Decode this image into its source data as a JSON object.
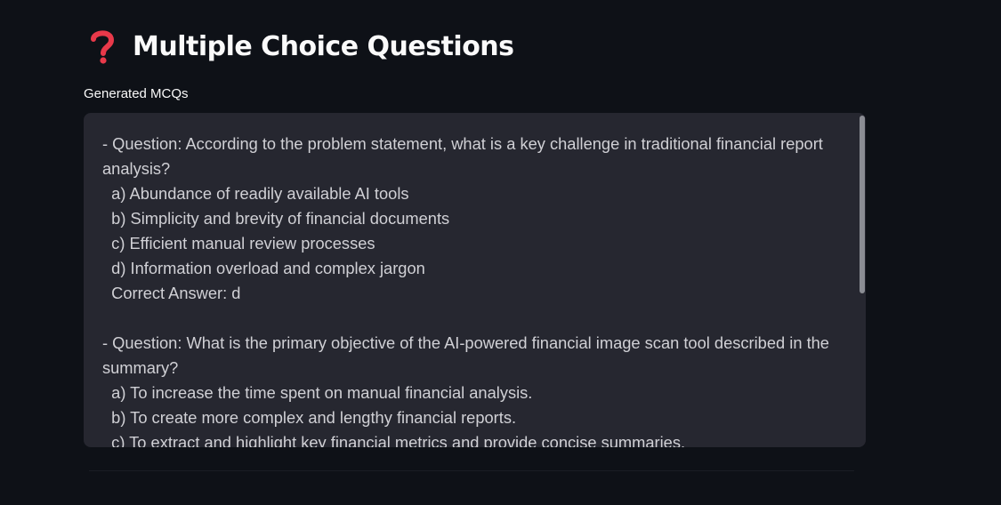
{
  "header": {
    "icon": "question-mark-icon",
    "title": "Multiple Choice Questions"
  },
  "mcq_field": {
    "label": "Generated MCQs",
    "value": "- Question: According to the problem statement, what is a key challenge in traditional financial report analysis?\n  a) Abundance of readily available AI tools\n  b) Simplicity and brevity of financial documents\n  c) Efficient manual review processes\n  d) Information overload and complex jargon\n  Correct Answer: d\n\n- Question: What is the primary objective of the AI-powered financial image scan tool described in the summary?\n  a) To increase the time spent on manual financial analysis.\n  b) To create more complex and lengthy financial reports.\n  c) To extract and highlight key financial metrics and provide concise summaries."
  },
  "colors": {
    "background": "#0e1117",
    "textarea_bg": "#262730",
    "icon_red": "#ff4b4b"
  }
}
